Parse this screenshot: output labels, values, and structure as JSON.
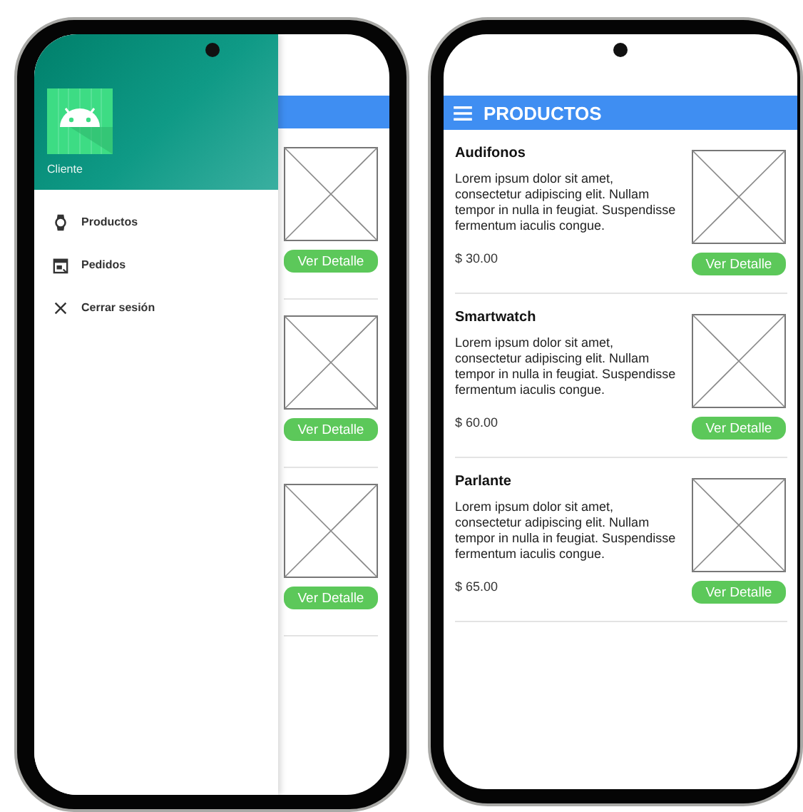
{
  "left_phone": {
    "drawer": {
      "header": {
        "user_name": "Cliente"
      },
      "items": [
        {
          "kind": "watch",
          "label": "Productos"
        },
        {
          "kind": "calendar",
          "label": "Pedidos"
        },
        {
          "kind": "close",
          "label": "Cerrar sesión"
        }
      ]
    },
    "list_behind": [
      {
        "button": "Ver Detalle"
      },
      {
        "button": "Ver Detalle"
      },
      {
        "button": "Ver Detalle"
      }
    ]
  },
  "right_phone": {
    "app_bar": {
      "title": "PRODUCTOS"
    },
    "products": [
      {
        "name": "Audifonos",
        "description": "Lorem ipsum dolor sit amet, consectetur adipiscing elit. Nullam tempor in nulla in feugiat. Suspendisse fermentum iaculis congue.",
        "price": "$ 30.00",
        "button": "Ver Detalle"
      },
      {
        "name": "Smartwatch",
        "description": "Lorem ipsum dolor sit amet, consectetur adipiscing elit. Nullam tempor in nulla in feugiat. Suspendisse fermentum iaculis congue.",
        "price": "$ 60.00",
        "button": "Ver Detalle"
      },
      {
        "name": "Parlante",
        "description": "Lorem ipsum dolor sit amet, consectetur adipiscing elit. Nullam tempor in nulla in feugiat. Suspendisse fermentum iaculis congue.",
        "price": "$ 65.00",
        "button": "Ver Detalle"
      }
    ]
  }
}
